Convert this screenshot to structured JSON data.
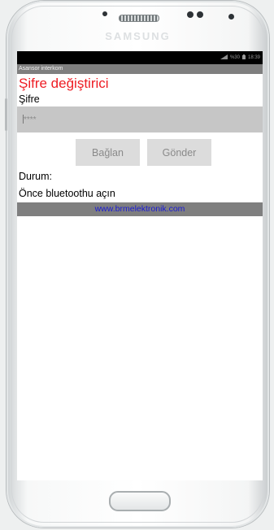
{
  "device": {
    "brand": "SAMSUNG"
  },
  "status_bar": {
    "signal_icon": "signal-icon",
    "battery_text": "%30",
    "time": "18:39"
  },
  "app": {
    "title": "Asansor interkom",
    "heading": "Şifre değiştirici",
    "password_label": "Şifre",
    "password_value": "****",
    "connect_button": "Bağlan",
    "send_button": "Gönder",
    "status_label": "Durum:",
    "status_message": "Önce bluetoothu açın",
    "website_link": "www.brmelektronik.com"
  },
  "colors": {
    "heading": "#ee1d24",
    "title_bar": "#7f7f7f",
    "link": "#1a1ad4",
    "input_background": "#c6c6c6"
  }
}
